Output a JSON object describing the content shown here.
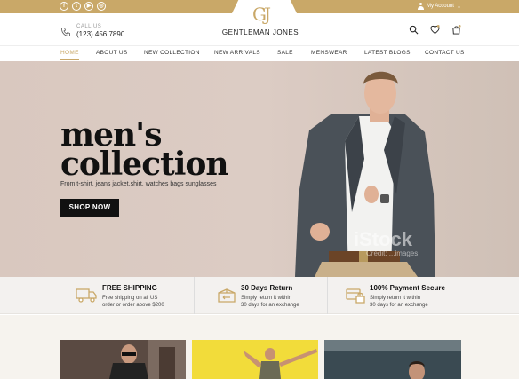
{
  "topbar": {
    "social": [
      {
        "icon": "facebook-icon",
        "glyph": "f"
      },
      {
        "icon": "twitter-icon",
        "glyph": "t"
      },
      {
        "icon": "youtube-icon",
        "glyph": "▶"
      },
      {
        "icon": "instagram-icon",
        "glyph": "◎"
      }
    ],
    "account_label": "My Account",
    "accent_color": "#c9a868"
  },
  "brand": {
    "monogram": "GJ",
    "name": "GENTLEMAN JONES"
  },
  "call": {
    "label": "CALL US",
    "number": "(123) 456 7890"
  },
  "header_icons": [
    "search-icon",
    "heart-icon",
    "cart-icon"
  ],
  "nav": {
    "items": [
      "HOME",
      "ABOUT US",
      "NEW COLLECTION",
      "NEW ARRIVALS",
      "SALE",
      "MENSWEAR",
      "LATEST BLOGS",
      "CONTACT US"
    ],
    "active": "HOME"
  },
  "hero": {
    "title_line1": "men's",
    "title_line2": "collection",
    "subtitle": "From t-shirt, jeans jacket,shirt, watches bags sunglasses",
    "cta": "SHOP NOW",
    "watermark": "iStock",
    "watermark_sub": "Credit: ...images"
  },
  "features": [
    {
      "icon": "truck-icon",
      "title": "FREE SHIPPING",
      "line1": "Free shipping on all US",
      "line2": "order or order above $200"
    },
    {
      "icon": "box-return-icon",
      "title": "30 Days Return",
      "line1": "Simply return it within",
      "line2": "30 days for an exchange"
    },
    {
      "icon": "secure-payment-icon",
      "title": "100% Payment Secure",
      "line1": "Simply return it within",
      "line2": "30 days for an exchange"
    }
  ]
}
